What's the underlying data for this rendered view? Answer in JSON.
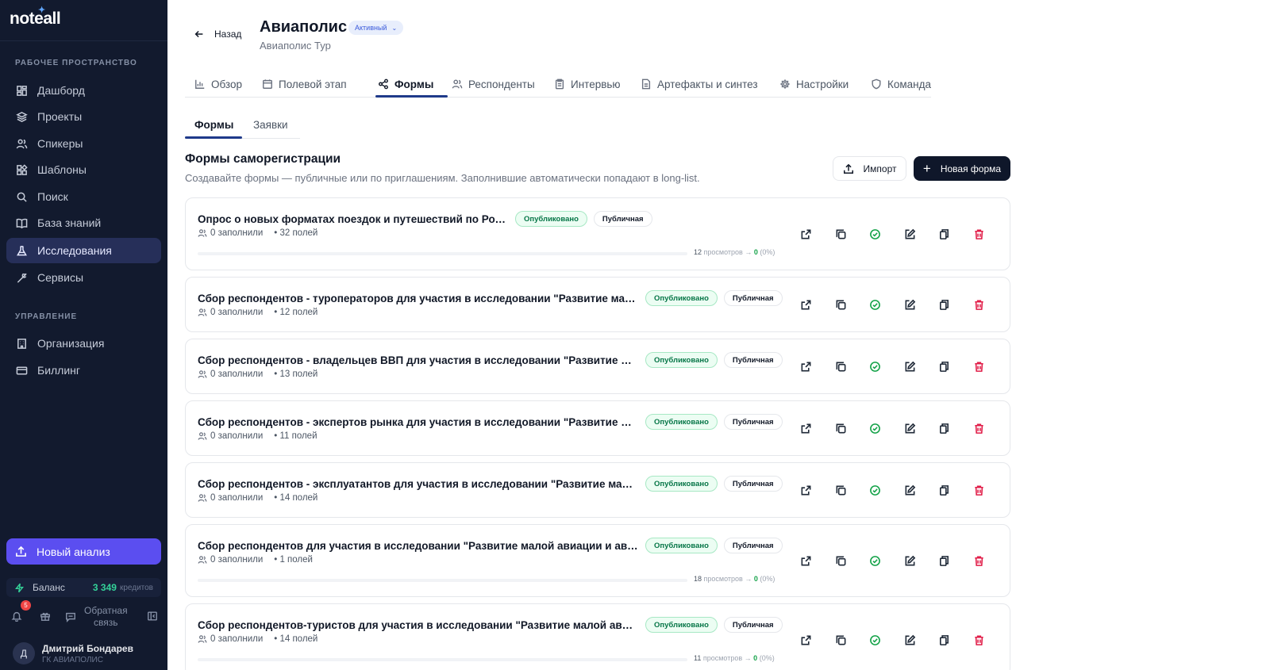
{
  "sidebar": {
    "logo": "noteall",
    "workspace_label": "РАБОЧЕЕ ПРОСТРАНСТВО",
    "items": [
      {
        "label": "Дашборд",
        "icon": "dashboard-icon"
      },
      {
        "label": "Проекты",
        "icon": "layers-icon"
      },
      {
        "label": "Спикеры",
        "icon": "users-icon"
      },
      {
        "label": "Шаблоны",
        "icon": "widgets-icon"
      },
      {
        "label": "Поиск",
        "icon": "search-icon"
      },
      {
        "label": "База знаний",
        "icon": "book-icon"
      },
      {
        "label": "Исследования",
        "icon": "flask-icon",
        "active": true
      },
      {
        "label": "Сервисы",
        "icon": "wrench-icon"
      }
    ],
    "manage_label": "УПРАВЛЕНИЕ",
    "manage_items": [
      {
        "label": "Организация",
        "icon": "building-icon"
      },
      {
        "label": "Биллинг",
        "icon": "card-icon"
      }
    ],
    "new_analysis": "Новый анализ",
    "balance_label": "Баланс",
    "balance_amount": "3 349",
    "balance_unit": "кредитов",
    "notifications_count": "5",
    "feedback_line1": "Обратная",
    "feedback_line2": "связь",
    "user_initial": "Д",
    "user_name": "Дмитрий Бондарев",
    "user_org": "ГК АВИАПОЛИС"
  },
  "header": {
    "back_label": "Назад",
    "title": "Авиаполис",
    "status": "Активный",
    "subtitle": "Авиаполис Тур"
  },
  "tabs": [
    {
      "label": "Обзор",
      "icon": "chart-icon"
    },
    {
      "label": "Полевой этап",
      "icon": "calendar-icon"
    },
    {
      "label": "Формы",
      "icon": "share-icon",
      "active": true
    },
    {
      "label": "Респонденты",
      "icon": "users-icon"
    },
    {
      "label": "Интервью",
      "icon": "clipboard-icon"
    },
    {
      "label": "Артефакты и синтез",
      "icon": "document-icon"
    },
    {
      "label": "Настройки",
      "icon": "gear-icon"
    },
    {
      "label": "Команда",
      "icon": "shield-icon"
    }
  ],
  "subtabs": [
    {
      "label": "Формы",
      "active": true
    },
    {
      "label": "Заявки"
    }
  ],
  "section": {
    "title": "Формы саморегистрации",
    "description": "Создавайте формы — публичные или по приглашениям. Заполнившие автоматически попадают в long-list.",
    "import_label": "Импорт",
    "new_form_label": "Новая форма"
  },
  "forms": [
    {
      "title": "Опрос о новых форматах поездок и путешествий по России",
      "status": "Опубликовано",
      "visibility": "Публичная",
      "filled": "0 заполнили",
      "fields": "• 32 полей",
      "views": "12",
      "views_label": "просмотров →",
      "conversions": "0",
      "rate": "(0%)"
    },
    {
      "title": "Сбор респондентов - туроператоров для участия в исследовании \"Развитие малой а...",
      "status": "Опубликовано",
      "visibility": "Публичная",
      "filled": "0 заполнили",
      "fields": "• 12 полей"
    },
    {
      "title": "Сбор респондентов - владельцев ВВП для участия в исследовании \"Развитие малой ...",
      "status": "Опубликовано",
      "visibility": "Публичная",
      "filled": "0 заполнили",
      "fields": "• 13 полей"
    },
    {
      "title": "Сбор респондентов - экспертов рынка для участия в исследовании \"Развитие малой...",
      "status": "Опубликовано",
      "visibility": "Публичная",
      "filled": "0 заполнили",
      "fields": "• 11 полей"
    },
    {
      "title": "Сбор респондентов - эксплуатантов для участия в исследовании \"Развитие малой а...",
      "status": "Опубликовано",
      "visibility": "Публичная",
      "filled": "0 заполнили",
      "fields": "• 14 полей"
    },
    {
      "title": "Сбор респондентов для участия в исследовании \"Развитие малой авиации и авиаци...",
      "status": "Опубликовано",
      "visibility": "Публичная",
      "filled": "0 заполнили",
      "fields": "• 1 полей",
      "views": "18",
      "views_label": "просмотров →",
      "conversions": "0",
      "rate": "(0%)"
    },
    {
      "title": "Сбор респондентов-туристов для участия в исследовании \"Развитие малой авиации...",
      "status": "Опубликовано",
      "visibility": "Публичная",
      "filled": "0 заполнили",
      "fields": "• 14 полей",
      "views": "11",
      "views_label": "просмотров →",
      "conversions": "0",
      "rate": "(0%)"
    }
  ],
  "card_actions": [
    "external-link-icon",
    "copy-icon",
    "check-circle-icon",
    "edit-icon",
    "duplicate-icon",
    "trash-icon"
  ],
  "colors": {
    "sidebar_bg": "#121a2e",
    "accent": "#5b4ef0",
    "published_green": "#067647",
    "delete_red": "#e11d48",
    "tab_underline": "#1f3a8a"
  }
}
